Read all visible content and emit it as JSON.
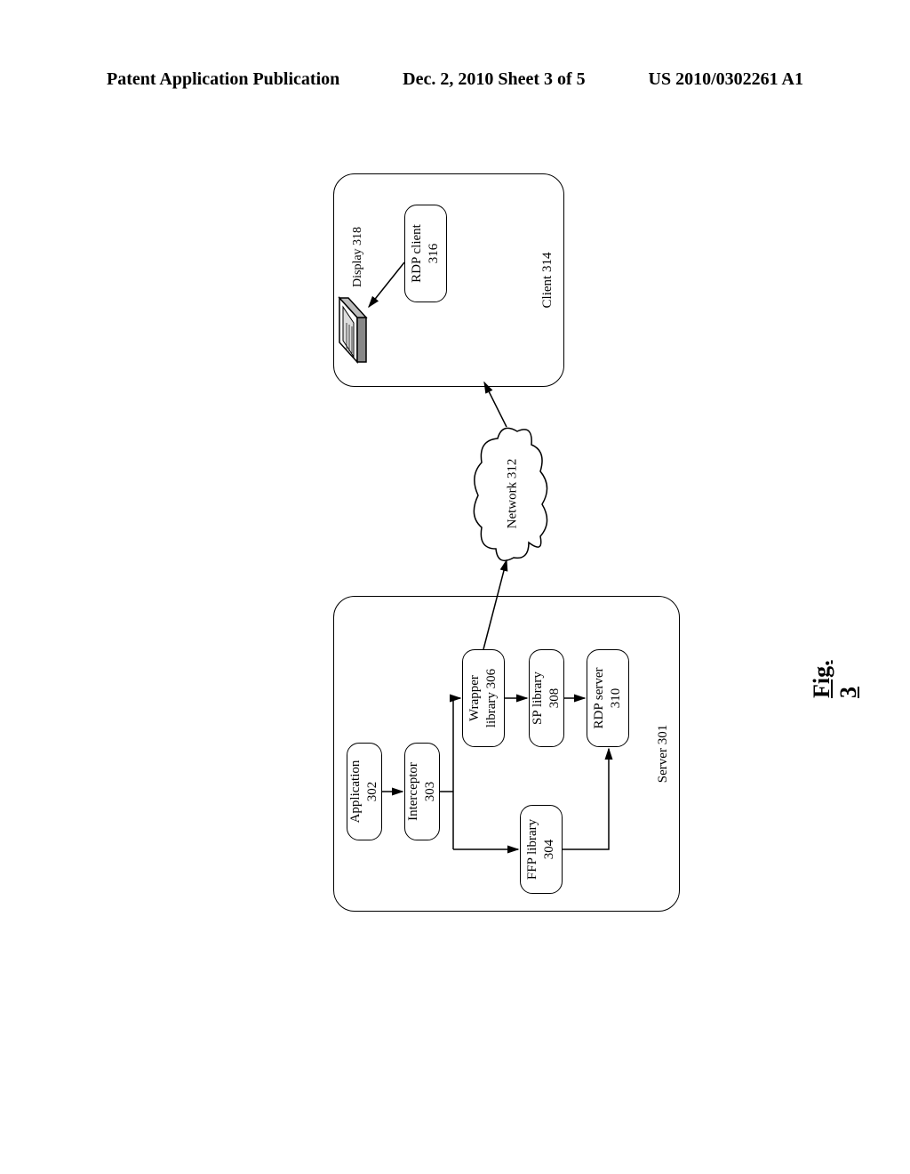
{
  "header": {
    "left": "Patent Application Publication",
    "center": "Dec. 2, 2010  Sheet 3 of 5",
    "right": "US 2010/0302261 A1"
  },
  "diagram": {
    "server": {
      "container_label": "Server 301",
      "app": {
        "label": "Application",
        "num": "302"
      },
      "interceptor": {
        "label": "Interceptor",
        "num": "303"
      },
      "ffp": {
        "label": "FFP library",
        "num": "304"
      },
      "wrapper": {
        "label": "Wrapper",
        "sub": "library 306"
      },
      "sp": {
        "label": "SP library",
        "num": "308"
      },
      "rdpserver": {
        "label": "RDP server",
        "num": "310"
      }
    },
    "network": {
      "label": "Network 312"
    },
    "client": {
      "container_label": "Client 314",
      "rdpclient": {
        "label": "RDP client",
        "num": "316"
      },
      "display_label": "Display 318"
    }
  },
  "figure_caption": "Fig. 3"
}
